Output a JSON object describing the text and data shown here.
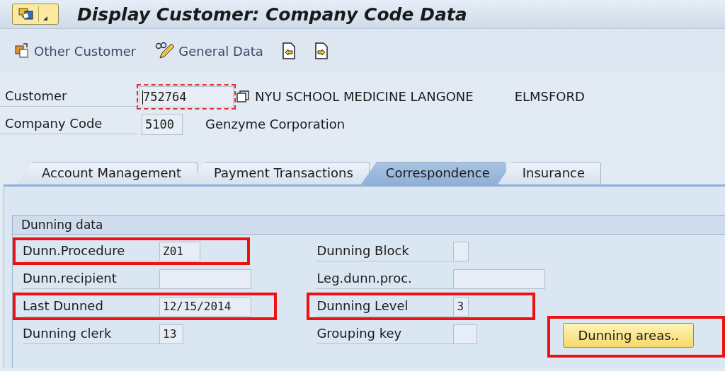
{
  "window": {
    "title": "Display Customer: Company Code Data"
  },
  "toolbar": [
    {
      "kind": "copy",
      "label": "Other Customer"
    },
    {
      "kind": "edit",
      "label": "General Data"
    },
    {
      "kind": "prev"
    },
    {
      "kind": "next"
    }
  ],
  "header": {
    "customer": {
      "label": "Customer",
      "value": "752764",
      "focused": true,
      "name": "NYU SCHOOL MEDICINE LANGONE",
      "city": "ELMSFORD"
    },
    "company_code": {
      "label": "Company Code",
      "value": "5100",
      "name": "Genzyme Corporation"
    }
  },
  "tabs": [
    {
      "label": "Account Management",
      "selected": false
    },
    {
      "label": "Payment Transactions",
      "selected": false
    },
    {
      "label": "Correspondence",
      "selected": true
    },
    {
      "label": "Insurance",
      "selected": false
    }
  ],
  "group": {
    "title": "Dunning data",
    "left": [
      {
        "label": "Dunn.Procedure",
        "value": "Z01",
        "highlighted": true
      },
      {
        "label": "Dunn.recipient",
        "highlighted": false
      },
      {
        "label": "Last Dunned",
        "value": "12/15/2014",
        "highlighted": true
      },
      {
        "label": "Dunning clerk",
        "value": "13",
        "highlighted": false
      }
    ],
    "right": [
      {
        "label": "Dunning Block",
        "highlighted": false
      },
      {
        "label": "Leg.dunn.proc.",
        "highlighted": false
      },
      {
        "label": "Dunning Level",
        "value": "3",
        "highlighted": true
      },
      {
        "label": "Grouping key",
        "highlighted": false
      }
    ],
    "button": {
      "label": "Dunning areas..",
      "highlighted": true
    }
  }
}
